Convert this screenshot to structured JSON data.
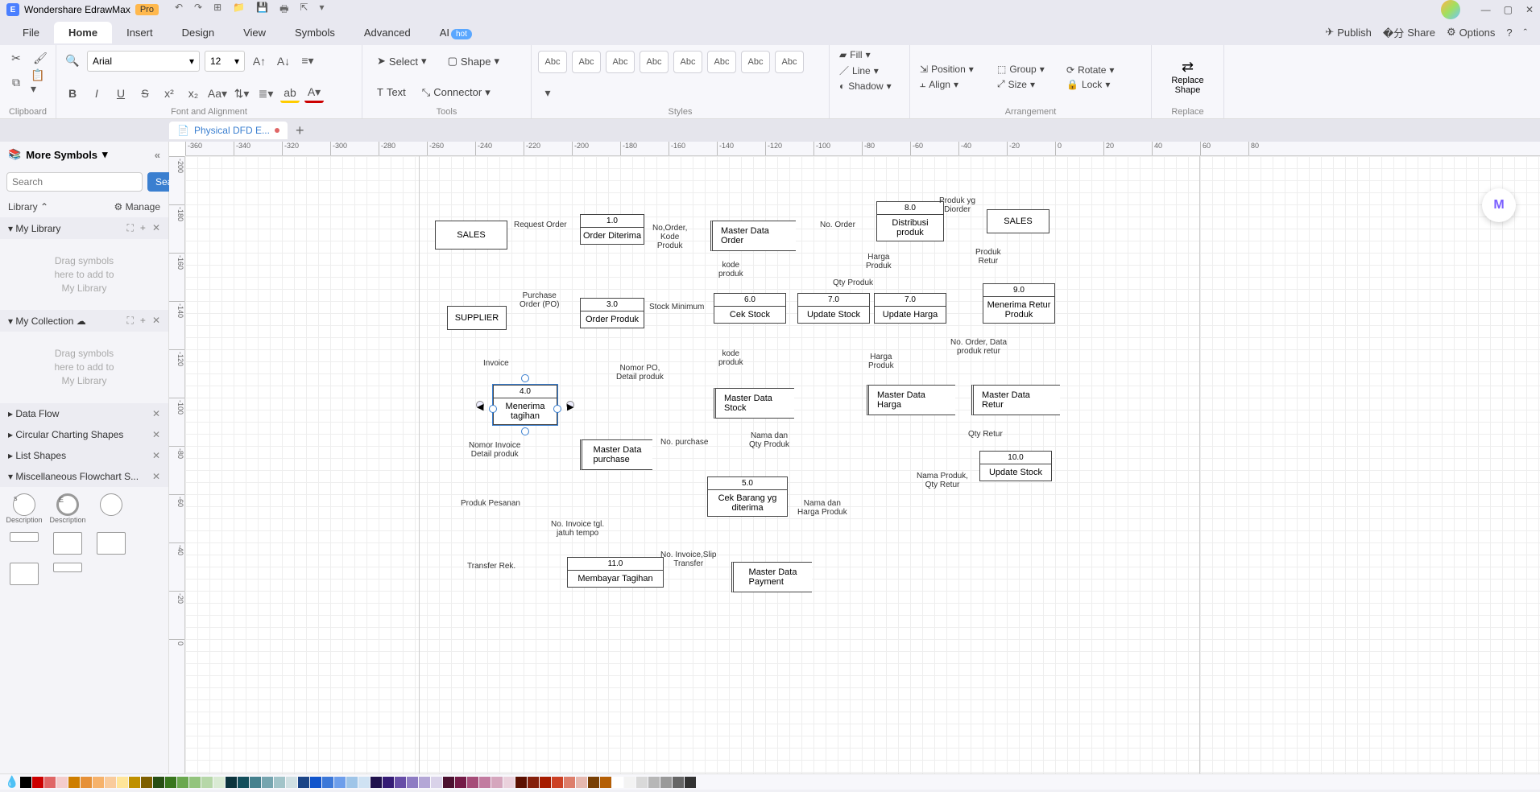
{
  "titlebar": {
    "app_name": "Wondershare EdrawMax",
    "pro_badge": "Pro"
  },
  "menubar": {
    "items": [
      "File",
      "Home",
      "Insert",
      "Design",
      "View",
      "Symbols",
      "Advanced",
      "AI"
    ],
    "hot": "hot",
    "publish": "Publish",
    "share": "Share",
    "options": "Options"
  },
  "ribbon": {
    "font_name": "Arial",
    "font_size": "12",
    "clipboard_label": "Clipboard",
    "font_label": "Font and Alignment",
    "tools_label": "Tools",
    "styles_label": "Styles",
    "arrangement_label": "Arrangement",
    "replace_label": "Replace",
    "select": "Select",
    "shape": "Shape",
    "text": "Text",
    "connector": "Connector",
    "style_swatch": "Abc",
    "fill": "Fill",
    "line": "Line",
    "shadow": "Shadow",
    "position": "Position",
    "group": "Group",
    "rotate": "Rotate",
    "align": "Align",
    "size": "Size",
    "lock": "Lock",
    "replace_shape": "Replace\nShape"
  },
  "doctab": {
    "name": "Physical DFD E..."
  },
  "leftpanel": {
    "title": "More Symbols",
    "search_placeholder": "Search",
    "search_btn": "Search",
    "library": "Library",
    "manage": "Manage",
    "my_library": "My Library",
    "my_collection": "My Collection",
    "drop_hint": "Drag symbols\nhere to add to\nMy Library",
    "sections": {
      "data_flow": "Data Flow",
      "circular": "Circular Charting Shapes",
      "list": "List Shapes",
      "misc": "Miscellaneous Flowchart S..."
    },
    "desc": "Description"
  },
  "ruler_h": [
    "-360",
    "-340",
    "-320",
    "-300",
    "-280",
    "-260",
    "-240",
    "-220",
    "-200",
    "-180",
    "-160",
    "-140",
    "-120",
    "-100",
    "-80",
    "-60",
    "-40",
    "-20",
    "0",
    "20",
    "40",
    "60",
    "80"
  ],
  "ruler_v": [
    "-200",
    "-180",
    "-160",
    "-140",
    "-120",
    "-100",
    "-80",
    "-60",
    "-40",
    "-20",
    "0"
  ],
  "dfd": {
    "entities": {
      "sales1": "SALES",
      "supplier": "SUPPLIER",
      "sales2": "SALES"
    },
    "processes": {
      "p1": {
        "id": "1.0",
        "name": "Order Diterima"
      },
      "p3": {
        "id": "3.0",
        "name": "Order Produk"
      },
      "p4": {
        "id": "4.0",
        "name": "Menerima\ntagihan"
      },
      "p5": {
        "id": "5.0",
        "name": "Cek Barang yg\nditerima"
      },
      "p6": {
        "id": "6.0",
        "name": "Cek Stock"
      },
      "p7": {
        "id": "7.0",
        "name": "Update Stock"
      },
      "p7b": {
        "id": "7.0",
        "name": "Update Harga"
      },
      "p8": {
        "id": "8.0",
        "name": "Distribusi\nproduk"
      },
      "p9": {
        "id": "9.0",
        "name": "Menerima Retur\nProduk"
      },
      "p10": {
        "id": "10.0",
        "name": "Update Stock"
      },
      "p11": {
        "id": "11.0",
        "name": "Membayar Tagihan"
      }
    },
    "stores": {
      "order": "Master Data Order",
      "stock": "Master Data Stock",
      "purchase": "Master Data\npurchase",
      "harga": "Master Data Harga",
      "retur": "Master Data Retur",
      "payment": "Master Data\nPayment"
    },
    "labels": {
      "request_order": "Request Order",
      "no_order_kode": "No,Order,\nKode\nProduk",
      "no_order": "No. Order",
      "produk_diorder": "Produk yg\nDiorder",
      "produk_retur": "Produk\nRetur",
      "harga_produk": "Harga\nProduk",
      "qty_produk": "Qty Produk",
      "kode_produk": "kode\nproduk",
      "kode_produk2": "kode\nproduk",
      "harga_produk2": "Harga\nProduk",
      "purchase_order": "Purchase\nOrder (PO)",
      "stock_min": "Stock Minimum",
      "invoice": "Invoice",
      "nomor_po": "Nomor PO,\nDetail produk",
      "nomor_invoice": "Nomor Invoice\nDetail produk",
      "no_purchase": "No. purchase",
      "nama_qty": "Nama dan\nQty Produk",
      "nama_harga": "Nama dan\nHarga Produk",
      "no_order_retur": "No. Order, Data\nproduk retur",
      "qty_retur": "Qty Retur",
      "nama_qty_retur": "Nama Produk,\nQty Retur",
      "produk_pesanan": "Produk Pesanan",
      "no_invoice_tgl": "No. Invoice tgl.\njatuh tempo",
      "no_invoice_slip": "No. Invoice,Slip\nTransfer",
      "transfer_rek": "Transfer Rek."
    }
  },
  "colors": [
    "#000000",
    "#cc0000",
    "#e06666",
    "#f4cccc",
    "#ce7e00",
    "#e69138",
    "#f6b26b",
    "#f9cb9c",
    "#ffe599",
    "#bf9000",
    "#7f6000",
    "#274e13",
    "#38761d",
    "#6aa84f",
    "#93c47d",
    "#b6d7a8",
    "#d9ead3",
    "#0c343d",
    "#134f5c",
    "#45818e",
    "#76a5af",
    "#a2c4c9",
    "#d0e0e3",
    "#1c4587",
    "#1155cc",
    "#3c78d8",
    "#6d9eeb",
    "#9fc5e8",
    "#cfe2f3",
    "#20124d",
    "#351c75",
    "#674ea7",
    "#8e7cc3",
    "#b4a7d6",
    "#d9d2e9",
    "#4c1130",
    "#741b47",
    "#a64d79",
    "#c27ba0",
    "#d5a6bd",
    "#ead1dc",
    "#5b0f00",
    "#85200c",
    "#a61c00",
    "#cc4125",
    "#dd7e6b",
    "#e6b8af",
    "#783f04",
    "#b45f06",
    "#ffffff",
    "#f3f3f3",
    "#d9d9d9",
    "#b7b7b7",
    "#999999",
    "#666666",
    "#333333"
  ]
}
